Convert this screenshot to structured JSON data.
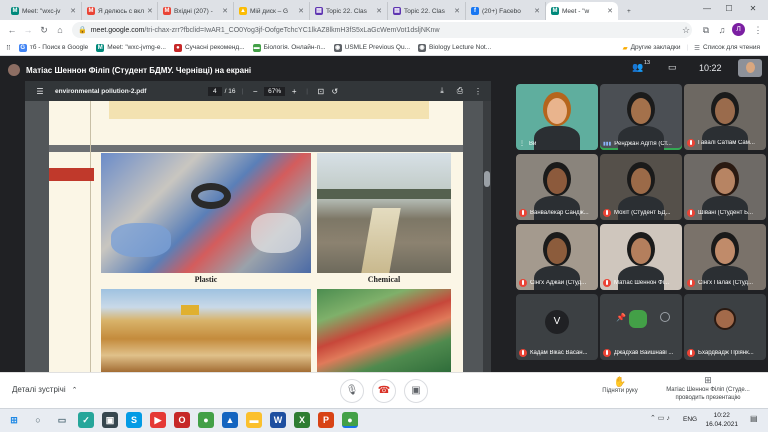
{
  "browser": {
    "tabs": [
      {
        "label": "Meet: \"wxc-jv",
        "color": "#00897b",
        "glyph": "M"
      },
      {
        "label": "Я делюсь с вкл",
        "color": "#ea4335",
        "glyph": "M"
      },
      {
        "label": "Вхідні (207) -",
        "color": "#ea4335",
        "glyph": "M"
      },
      {
        "label": "Мій диск – G",
        "color": "#fbbc04",
        "glyph": "▲"
      },
      {
        "label": "Topic 22. Clas",
        "color": "#5e35b1",
        "glyph": "▤"
      },
      {
        "label": "Topic 22. Clas",
        "color": "#5e35b1",
        "glyph": "▤"
      },
      {
        "label": "(20+) Facebo",
        "color": "#1877f2",
        "glyph": "f"
      },
      {
        "label": "Meet - \"w",
        "color": "#00897b",
        "glyph": "M"
      }
    ],
    "new_tab": "+",
    "window_controls": [
      "—",
      "☐",
      "✕"
    ],
    "url_host": "meet.google.com",
    "url_path": "/tri-chax-zrr?fbclid=IwAR1_CO0Yog3jf-OofgeTchcYC1lkAZ8lkmH3fS5xLaGcWemVot1dsljNKnw",
    "profile_initial": "Л",
    "bookmarks": [
      {
        "label": "тб - Поиск в Google",
        "color": "#4285f4",
        "glyph": "G"
      },
      {
        "label": "Meet: \"wxc-jvmg-e...",
        "color": "#00897b",
        "glyph": "M"
      },
      {
        "label": "Сучасні рекоменд...",
        "color": "#c62828",
        "glyph": "●"
      },
      {
        "label": "Біологія. Онлайн-п...",
        "color": "#43a047",
        "glyph": "▬"
      },
      {
        "label": "USMLE Previous Qu...",
        "color": "#5f6368",
        "glyph": "◉"
      },
      {
        "label": "Biology Lecture Not...",
        "color": "#5f6368",
        "glyph": "◉"
      }
    ],
    "bookmarks_right": [
      "Другие закладки",
      "Список для чтения"
    ]
  },
  "meet": {
    "presenter_label": "Матіас Шеннон Філіп (Студент БДМУ. Чернівці) на екрані",
    "participants_count": "13",
    "clock": "10:22",
    "pdf": {
      "filename": "environmental pollution-2.pdf",
      "page_current": "4",
      "page_total": "/ 16",
      "zoom": "67%",
      "captions": [
        "Plastic",
        "Chemical"
      ]
    },
    "tiles": [
      {
        "name": "Ви",
        "mic": "on",
        "bg": "#5fae9e",
        "skin": "#e9b48d",
        "hair": "#b5651d"
      },
      {
        "name": "Ренджан Адітія (Ст...",
        "mic": "speaking",
        "bg": "#4b4f54",
        "skin": "#a4714b",
        "hair": "#1b1b1b"
      },
      {
        "name": "Гавалі Сатіам Сам...",
        "mic": "off",
        "bg": "#6d6862",
        "skin": "#9a6b4c",
        "hair": "#1b1b1b"
      },
      {
        "name": "Ванвалекар Сандж...",
        "mic": "off",
        "bg": "#8a847c",
        "skin": "#8c5a3c",
        "hair": "#1a1a1a"
      },
      {
        "name": "Мохіт (Студент БД...",
        "mic": "off",
        "bg": "#55504a",
        "skin": "#9b6a48",
        "hair": "#1a1a1a"
      },
      {
        "name": "Шівані (Студент Б...",
        "mic": "off",
        "bg": "#6e6a66",
        "skin": "#b78463",
        "hair": "#2a1a12"
      },
      {
        "name": "Сінгх Аджай (Студ...",
        "mic": "off",
        "bg": "#a49a8e",
        "skin": "#8c5c3c",
        "hair": "#1b1b1b"
      },
      {
        "name": "Матіас Шеннон Фі...",
        "mic": "off",
        "bg": "#cfc6bd",
        "skin": "#b47f5d",
        "hair": "#1b1b1b"
      },
      {
        "name": "Сінгх Палак (Студ...",
        "mic": "off",
        "bg": "#7a726a",
        "skin": "#c08b6a",
        "hair": "#1a1a1a"
      },
      {
        "name": "Кадам Вікас Васан...",
        "mic": "off",
        "bg": "#3c4043",
        "avatar": "V",
        "avatar_color": "#202124"
      },
      {
        "name": "Джадхав Вайшнаві ...",
        "mic": "off",
        "bg": "#3c4043",
        "avatar": "",
        "avatar_color": "#43a047"
      },
      {
        "name": "Бхардвадж Пріянк...",
        "mic": "off",
        "bg": "#3c4043",
        "avatar_img": true,
        "skin": "#a36a4a"
      }
    ]
  },
  "bottom": {
    "details_label": "Деталі зустрічі",
    "raise_hand_label": "Підняти руку",
    "present_label": "Матіас Шеннон Філіп (Студе... проводить презентацію"
  },
  "taskbar": {
    "lang": "ENG",
    "time": "10:22",
    "date": "16.04.2021",
    "icons": [
      {
        "name": "windows-start-icon",
        "color": "#1e88e5",
        "glyph": "⊞"
      },
      {
        "name": "search-icon",
        "color": "#455a64",
        "glyph": "○"
      },
      {
        "name": "task-view-icon",
        "color": "#546e7a",
        "glyph": "▭"
      },
      {
        "name": "app-icon-1",
        "color": "#26a69a",
        "glyph": "✓"
      },
      {
        "name": "store-icon",
        "color": "#37474f",
        "glyph": "▣"
      },
      {
        "name": "skype-icon",
        "color": "#039be5",
        "glyph": "S"
      },
      {
        "name": "app-icon-2",
        "color": "#e53935",
        "glyph": "▶"
      },
      {
        "name": "opera-icon",
        "color": "#c62828",
        "glyph": "O"
      },
      {
        "name": "chrome-icon",
        "color": "#43a047",
        "glyph": "●"
      },
      {
        "name": "photos-icon",
        "color": "#1565c0",
        "glyph": "▲"
      },
      {
        "name": "explorer-icon",
        "color": "#fbc02d",
        "glyph": "▬"
      },
      {
        "name": "word-icon",
        "color": "#1e4fa0",
        "glyph": "W"
      },
      {
        "name": "excel-icon",
        "color": "#2e7d32",
        "glyph": "X"
      },
      {
        "name": "powerpoint-icon",
        "color": "#d84315",
        "glyph": "P"
      },
      {
        "name": "chrome-active-icon",
        "color": "#43a047",
        "glyph": "●"
      }
    ]
  }
}
